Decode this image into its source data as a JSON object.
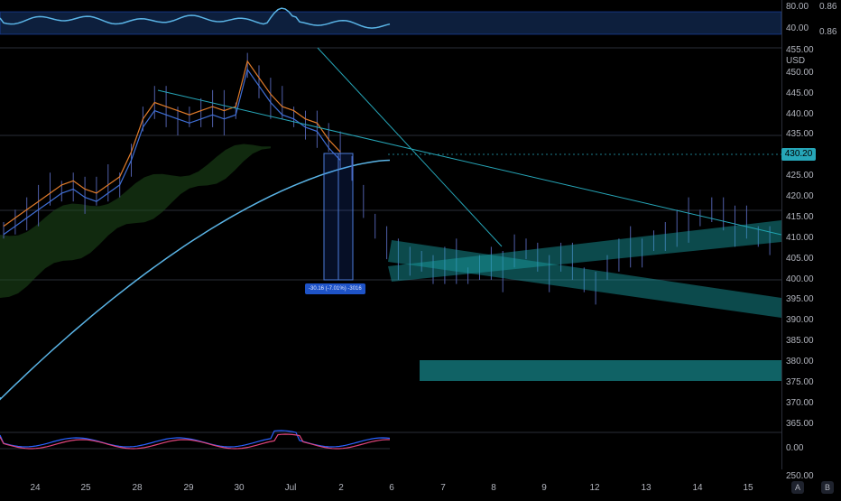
{
  "chart_data": {
    "type": "line",
    "title": "",
    "price_axis_unit": "USD",
    "current_price": "430.20",
    "price_ticks": [
      "455.00",
      "450.00",
      "445.00",
      "440.00",
      "435.00",
      "425.00",
      "420.00",
      "415.00",
      "410.00",
      "405.00",
      "400.00",
      "395.00",
      "390.00",
      "385.00",
      "380.00",
      "375.00",
      "370.00",
      "365.00",
      "0.00",
      "250.00"
    ],
    "x_ticks": [
      "24",
      "25",
      "28",
      "29",
      "30",
      "Jul",
      "2",
      "6",
      "7",
      "8",
      "9",
      "12",
      "13",
      "14",
      "15"
    ],
    "top_indicator": {
      "ticks": [
        "80.00",
        "40.00"
      ],
      "side_values": [
        "0.86",
        "0.86"
      ]
    },
    "measurement_label": "-30.16 (-7.01%) -3016",
    "zones": [
      {
        "name": "support box",
        "price_low": 375,
        "price_high": 380
      },
      {
        "name": "rising channel",
        "price_low": 402,
        "price_high": 415
      },
      {
        "name": "falling channel",
        "price_low": 390,
        "price_high": 408
      }
    ],
    "colors": {
      "candle": "#4f5ea8",
      "ma_long": "#5ab4e6",
      "ma_fast": "#e07b2a",
      "ma_mid": "#3f6fd6",
      "zone": "#1aa3a8",
      "price_tag": "#26a6b8"
    }
  },
  "buttons": {
    "auto": "A",
    "book": "B"
  }
}
